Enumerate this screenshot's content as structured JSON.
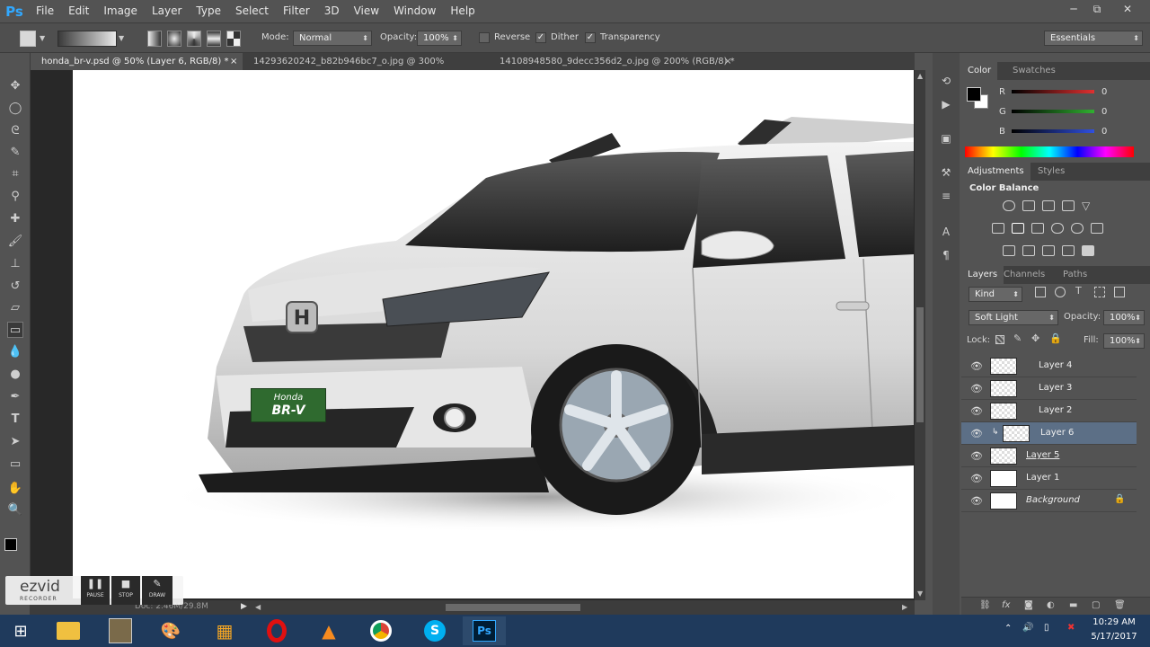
{
  "app": {
    "logo": "Ps"
  },
  "menubar": {
    "items": [
      "File",
      "Edit",
      "Image",
      "Layer",
      "Type",
      "Select",
      "Filter",
      "3D",
      "View",
      "Window",
      "Help"
    ]
  },
  "window_controls": {
    "minimize": "─",
    "restore": "⧉",
    "close": "✕"
  },
  "options": {
    "mode_label": "Mode:",
    "mode_value": "Normal",
    "opacity_label": "Opacity:",
    "opacity_value": "100%",
    "reverse_label": "Reverse",
    "dither_label": "Dither",
    "transparency_label": "Transparency",
    "reverse_checked": false,
    "dither_checked": true,
    "transparency_checked": true,
    "workspace": "Essentials"
  },
  "tabs": [
    {
      "label": "honda_br-v.psd @ 50% (Layer 6, RGB/8) *",
      "close": "×"
    },
    {
      "label": "14293620242_b82b946bc7_o.jpg @ 300% (RGB/8) *",
      "close": "×"
    },
    {
      "label": "14108948580_9decc356d2_o.jpg @ 200% (RGB/8) *",
      "close": "×"
    }
  ],
  "color_panel": {
    "tabs": [
      "Color",
      "Swatches"
    ],
    "channels": [
      {
        "label": "R",
        "value": "0",
        "color": "#e03030"
      },
      {
        "label": "G",
        "value": "0",
        "color": "#30b030"
      },
      {
        "label": "B",
        "value": "0",
        "color": "#3050e0"
      }
    ]
  },
  "adjustments_panel": {
    "tabs": [
      "Adjustments",
      "Styles"
    ],
    "title": "Color Balance"
  },
  "layers_panel": {
    "tabs": [
      "Layers",
      "Channels",
      "Paths"
    ],
    "filter_kind": "Kind",
    "blend_mode": "Soft Light",
    "opacity_label": "Opacity:",
    "opacity_value": "100%",
    "lock_label": "Lock:",
    "fill_label": "Fill:",
    "fill_value": "100%",
    "layers": [
      {
        "name": "Layer 4",
        "selected": false
      },
      {
        "name": "Layer 3",
        "selected": false
      },
      {
        "name": "Layer 2",
        "selected": false
      },
      {
        "name": "Layer 6",
        "selected": true
      },
      {
        "name": "Layer 5",
        "selected": false
      },
      {
        "name": "Layer 1",
        "selected": false
      },
      {
        "name": "Background",
        "selected": false
      }
    ]
  },
  "status": {
    "doc_size": "Doc: 2.46M/29.8M"
  },
  "recorder": {
    "brand": "ezvid",
    "sub": "RECORDER",
    "pause": "PAUSE",
    "stop": "STOP",
    "draw": "DRAW"
  },
  "car_badge": {
    "make": "Honda",
    "model": "BR-V"
  },
  "taskbar": {
    "time": "10:29 AM",
    "date": "5/17/2017"
  },
  "colors": {
    "accent": "#31a8ff",
    "selected_layer": "#5c6f86",
    "panel_bg": "#535353"
  }
}
